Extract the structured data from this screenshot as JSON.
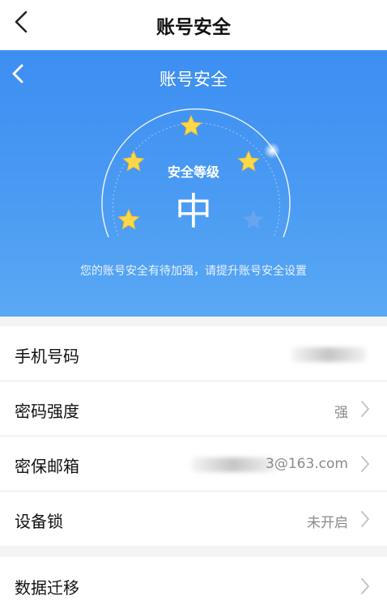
{
  "header": {
    "title": "账号安全",
    "back_icon": "chevron-left-icon"
  },
  "hero": {
    "title": "账号安全",
    "back_icon": "chevron-left-icon",
    "level_label": "安全等级",
    "level_value": "中",
    "stars_filled": 4,
    "stars_total": 5,
    "tip": "您的账号安全有待加强，请提升账号安全设置",
    "colors": {
      "gradient_top": "#3c8ef2",
      "gradient_bottom": "#5aa9f4",
      "star": "#ffd84a"
    }
  },
  "settings": [
    {
      "label": "手机号码",
      "value": ""
    },
    {
      "label": "密码强度",
      "value": "强"
    },
    {
      "label": "密保邮箱",
      "value": "3@163.com"
    },
    {
      "label": "设备锁",
      "value": "未开启"
    }
  ],
  "settings2": [
    {
      "label": "数据迁移",
      "value": ""
    }
  ]
}
